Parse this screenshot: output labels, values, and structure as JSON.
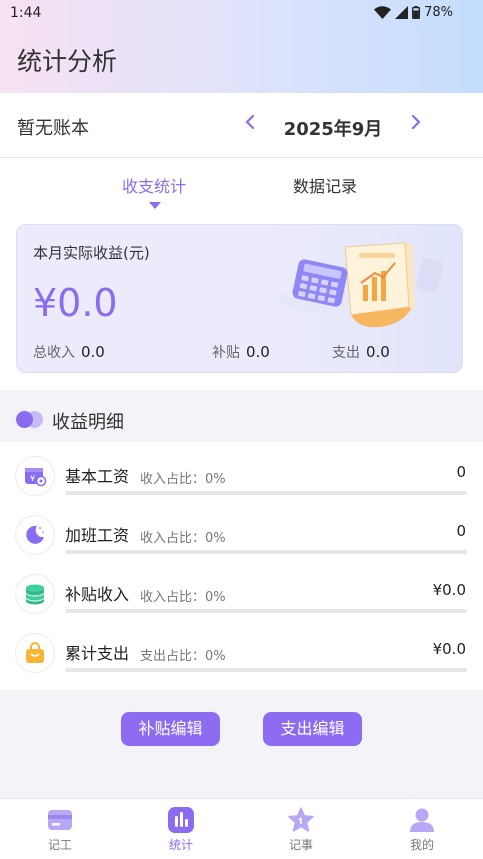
{
  "status_bar": {
    "time": "1:44",
    "battery": "78%"
  },
  "header": {
    "title": "统计分析"
  },
  "account": {
    "name": "暂无账本",
    "month": "2025年9月",
    "prev": "‹",
    "next": "›"
  },
  "tabs": [
    {
      "label": "收支统计",
      "active": true
    },
    {
      "label": "数据记录",
      "active": false
    }
  ],
  "summary": {
    "label": "本月实际收益(元)",
    "amount": "¥0.0",
    "income_label": "总收入",
    "income_value": "0.0",
    "subsidy_label": "补贴",
    "subsidy_value": "0.0",
    "expense_label": "支出",
    "expense_value": "0.0"
  },
  "details": {
    "title": "收益明细",
    "rows": [
      {
        "name": "基本工资",
        "ratio": "收入占比：0%",
        "value": "0",
        "icon": "wallet-icon"
      },
      {
        "name": "加班工资",
        "ratio": "收入占比：0%",
        "value": "0",
        "icon": "moon-icon"
      },
      {
        "name": "补贴收入",
        "ratio": "收入占比：0%",
        "value": "¥0.0",
        "icon": "coins-icon"
      },
      {
        "name": "累计支出",
        "ratio": "支出占比：0%",
        "value": "¥0.0",
        "icon": "bag-icon"
      }
    ]
  },
  "buttons": {
    "subsidy_edit": "补贴编辑",
    "expense_edit": "支出编辑"
  },
  "nav": [
    {
      "label": "记工",
      "icon": "card-icon",
      "active": false
    },
    {
      "label": "统计",
      "icon": "chart-icon",
      "active": true
    },
    {
      "label": "记事",
      "icon": "star-icon",
      "active": false
    },
    {
      "label": "我的",
      "icon": "person-icon",
      "active": false
    }
  ],
  "colors": {
    "accent": "#8a6cf0",
    "coins": "#3fcf9a",
    "bag": "#f7b531"
  }
}
